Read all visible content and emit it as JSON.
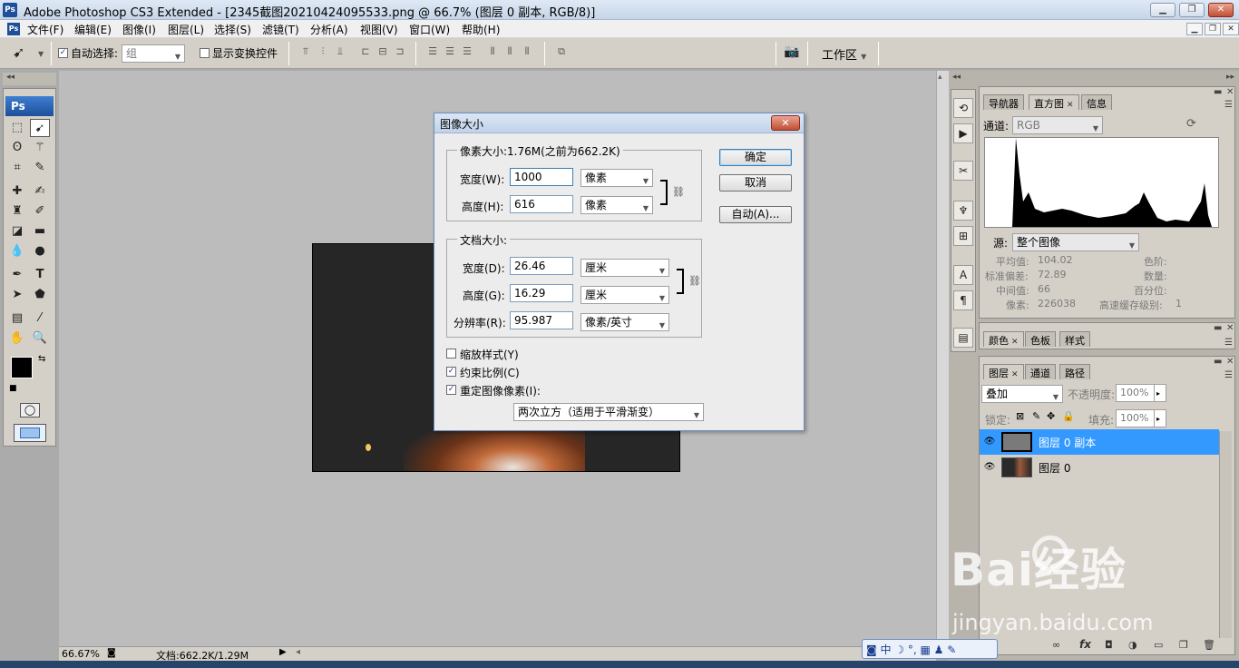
{
  "app": {
    "title": "Adobe Photoshop CS3 Extended - [2345截图20210424095533.png @ 66.7% (图层 0 副本, RGB/8)]",
    "logo": "Ps"
  },
  "menu": [
    "文件(F)",
    "编辑(E)",
    "图像(I)",
    "图层(L)",
    "选择(S)",
    "滤镜(T)",
    "分析(A)",
    "视图(V)",
    "窗口(W)",
    "帮助(H)"
  ],
  "options": {
    "auto_select_label": "自动选择:",
    "auto_select_checked": true,
    "auto_select_value": "组",
    "show_transform_label": "显示变换控件",
    "workspace_label": "工作区"
  },
  "toolbox": {
    "badge": "Ps"
  },
  "status": {
    "zoom": "66.67%",
    "doc": "文档:662.2K/1.29M"
  },
  "dialog": {
    "title": "图像大小",
    "pixel_legend": "像素大小:1.76M(之前为662.2K)",
    "width_label": "宽度(W):",
    "width_value": "1000",
    "width_unit": "像素",
    "height_label": "高度(H):",
    "height_value": "616",
    "height_unit": "像素",
    "doc_legend": "文档大小:",
    "doc_width_label": "宽度(D):",
    "doc_width_value": "26.46",
    "doc_width_unit": "厘米",
    "doc_height_label": "高度(G):",
    "doc_height_value": "16.29",
    "doc_height_unit": "厘米",
    "res_label": "分辨率(R):",
    "res_value": "95.987",
    "res_unit": "像素/英寸",
    "scale_styles": "缩放样式(Y)",
    "scale_styles_checked": false,
    "constrain": "约束比例(C)",
    "constrain_checked": true,
    "resample": "重定图像像素(I):",
    "resample_checked": true,
    "resample_method": "两次立方（适用于平滑渐变）",
    "ok": "确定",
    "cancel": "取消",
    "auto": "自动(A)..."
  },
  "navigator_panel": {
    "tabs": [
      "导航器",
      "直方图",
      "信息"
    ],
    "channel_label": "通道:",
    "channel_value": "RGB",
    "source_label": "源:",
    "source_value": "整个图像",
    "stats": {
      "mean_label": "平均值:",
      "mean": "104.02",
      "std_label": "标准偏差:",
      "std": "72.89",
      "median_label": "中间值:",
      "median": "66",
      "pixels_label": "像素:",
      "pixels": "226038",
      "level_label": "色阶:",
      "count_label": "数量:",
      "percentile_label": "百分位:",
      "cache_label": "高速缓存级别:",
      "cache": "1"
    }
  },
  "color_panel": {
    "tabs": [
      "颜色",
      "色板",
      "样式"
    ]
  },
  "layers_panel": {
    "tabs": [
      "图层",
      "通道",
      "路径"
    ],
    "blend_mode": "叠加",
    "opacity_label": "不透明度:",
    "opacity": "100%",
    "lock_label": "锁定:",
    "fill_label": "填充:",
    "fill": "100%",
    "layers": [
      {
        "name": "图层 0 副本",
        "selected": true
      },
      {
        "name": "图层 0",
        "selected": false
      }
    ]
  },
  "watermark": {
    "brand": "Bai经验",
    "url": "jingyan.baidu.com"
  },
  "ime": {
    "lang": "中"
  },
  "colors": {
    "selection": "#3399ff",
    "dialog_border": "#6d8fbd",
    "ps_blue": "#1d4f9a"
  }
}
